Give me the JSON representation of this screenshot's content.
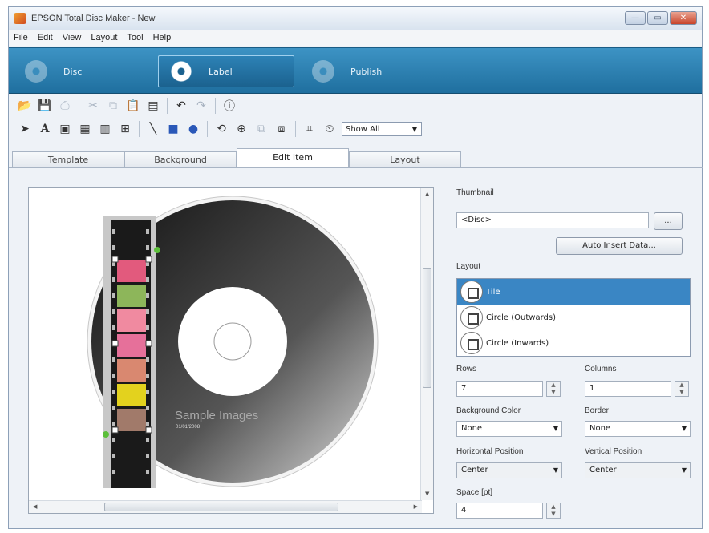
{
  "window": {
    "title": "EPSON Total Disc Maker - New"
  },
  "menu": [
    "File",
    "Edit",
    "View",
    "Layout",
    "Tool",
    "Help"
  ],
  "modes": [
    {
      "label": "Disc"
    },
    {
      "label": "Label"
    },
    {
      "label": "Publish"
    }
  ],
  "toolbar": {
    "show_filter": "Show All"
  },
  "tabs": [
    "Template",
    "Background",
    "Edit Item",
    "Layout"
  ],
  "canvas": {
    "text_title": "Sample Images",
    "text_date": "01/01/2008"
  },
  "panel": {
    "thumbnail_label": "Thumbnail",
    "thumbnail_value": "<Disc>",
    "browse_button": "...",
    "auto_insert_button": "Auto Insert Data...",
    "layout_label": "Layout",
    "layout_items": [
      "Tile",
      "Circle (Outwards)",
      "Circle (Inwards)"
    ],
    "rows_label": "Rows",
    "rows_value": "7",
    "columns_label": "Columns",
    "columns_value": "1",
    "bg_color_label": "Background Color",
    "bg_color_value": "None",
    "border_label": "Border",
    "border_value": "None",
    "hpos_label": "Horizontal Position",
    "hpos_value": "Center",
    "vpos_label": "Vertical Position",
    "vpos_value": "Center",
    "space_label": "Space [pt]",
    "space_value": "4"
  }
}
